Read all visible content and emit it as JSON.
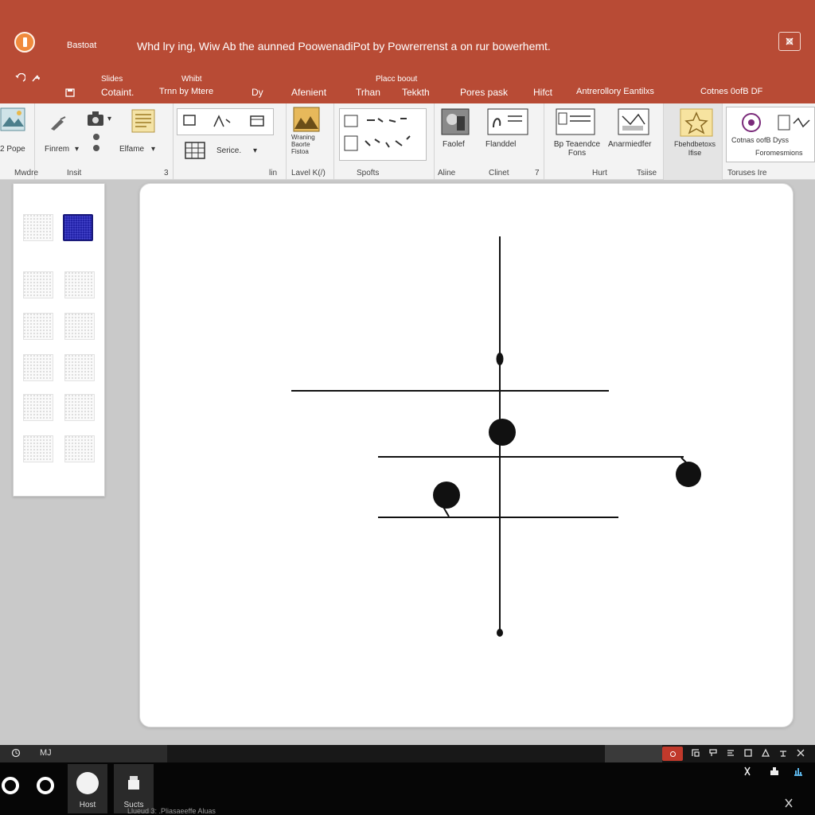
{
  "window": {
    "app_name": "Bastoat",
    "doc_title": "Whd lry ing, Wiw Ab the aunned PoowenadiPot by Powrerrenst a on rur bowerhemt.",
    "icons": [
      "app-logo-icon",
      "restore-icon"
    ]
  },
  "quick_access": {
    "icons": [
      "undo-icon",
      "redo-icon",
      "save-icon"
    ]
  },
  "tab_groups": [
    "Slides",
    "Whibt",
    "Placc boout"
  ],
  "tabs": [
    "Cotaint.",
    "Trnn by Mtere",
    "Dy",
    "Afenient",
    "Trhan",
    "Tekkth",
    "Pores pask",
    "Hifct",
    "Antrerollory Eantilxs",
    "Cotnes 0ofB DF"
  ],
  "ribbon": {
    "groups": [
      {
        "label": "Mwdre",
        "buttons": [
          "2 Pope"
        ]
      },
      {
        "label": "Insit",
        "buttons": [
          "Finrem",
          "Elfame"
        ]
      },
      {
        "label": "lin",
        "buttons": [
          "Serice."
        ]
      },
      {
        "label": "Lavel K(/)",
        "buttons": [
          "Wraning Baorte Fistoa"
        ]
      },
      {
        "label": "Spofts",
        "buttons": []
      },
      {
        "label": "Aline",
        "buttons": [
          "Faolef",
          "Flanddel"
        ]
      },
      {
        "label": "Clinet",
        "buttons": []
      },
      {
        "label": "Hurt",
        "buttons": [
          "Bp Teaendce Fons",
          "Anarmiedfer"
        ]
      },
      {
        "label": "Tsiise",
        "buttons": [
          "Fbehdbetoxs Ifise"
        ]
      },
      {
        "label": "Toruses Ire",
        "buttons": [
          "Cotnas oofB Dyss",
          "Foromesmions"
        ]
      }
    ],
    "group_corner_marks": [
      "3",
      "7"
    ],
    "dropdown_marks": [
      "▾",
      "▾",
      "▾",
      "▾"
    ],
    "icons": [
      "picture-icon",
      "camera-icon",
      "clipboard-icon",
      "shapes-icon",
      "chart-icon",
      "table-icon",
      "image-icon",
      "smartart-icon",
      "star-icon",
      "circle-icon"
    ]
  },
  "thumbnails": {
    "count": 11,
    "selected_index": 1
  },
  "slide": {
    "shapes": [
      "vertical-axis",
      "horizontal-line-top",
      "horizontal-line-middle",
      "horizontal-line-bottom",
      "dot-center",
      "dot-right",
      "dot-left"
    ]
  },
  "statusbar": {
    "left_text": "MJ",
    "icons": [
      "notes-icon",
      "record-icon",
      "view-icons"
    ]
  },
  "taskbar": {
    "apps": [
      {
        "label": "Host"
      },
      {
        "label": "Sucts"
      }
    ],
    "under_text": "Llueud 3: .Pliasaeeffe Aluas"
  },
  "colors": {
    "titlebar": "#b84b35",
    "ribbon": "#f3f3f3",
    "workspace": "#c9c9c9",
    "slide": "#ffffff",
    "taskbar": "#060606",
    "selected_thumb": "#2222a8"
  }
}
